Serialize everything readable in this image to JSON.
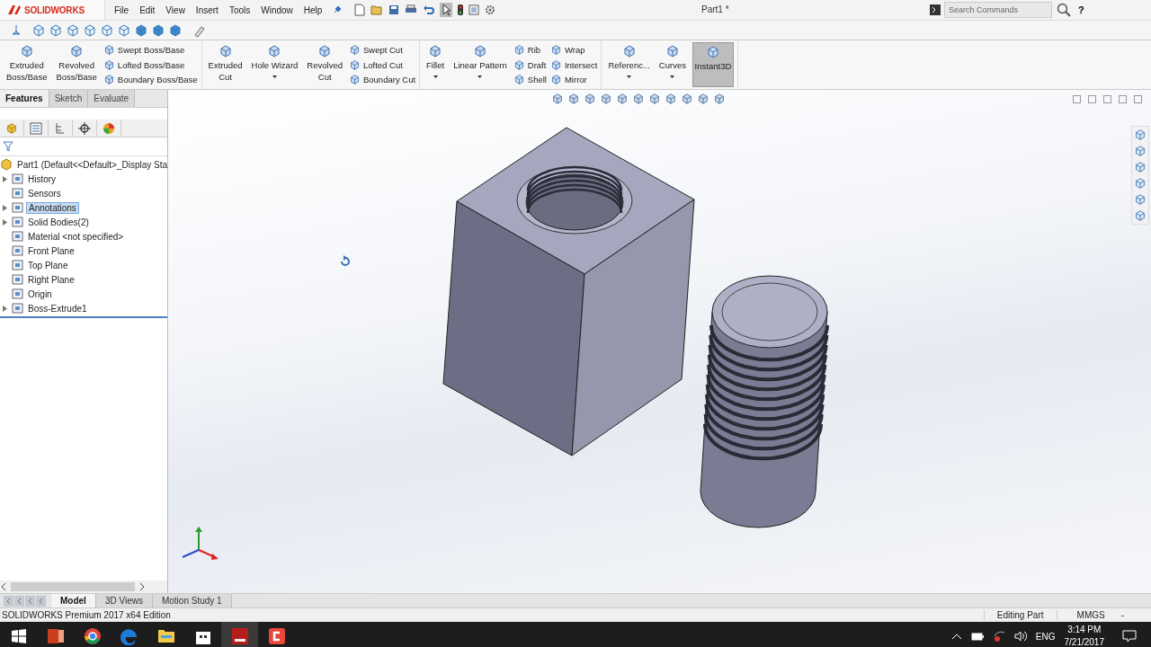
{
  "app": {
    "logo_text": "SOLIDWORKS",
    "menu": [
      "File",
      "Edit",
      "View",
      "Insert",
      "Tools",
      "Window",
      "Help"
    ],
    "document_title": "Part1 *",
    "search": {
      "placeholder": "Search Commands"
    },
    "help": "?"
  },
  "ribbon": [
    {
      "items": [
        {
          "kind": "large",
          "lines": [
            "Extruded",
            "Boss/Base"
          ]
        },
        {
          "kind": "large",
          "lines": [
            "Revolved",
            "Boss/Base"
          ]
        },
        {
          "kind": "stack",
          "labels": [
            "Swept Boss/Base",
            "Lofted Boss/Base",
            "Boundary Boss/Base"
          ]
        }
      ]
    },
    {
      "items": [
        {
          "kind": "large",
          "lines": [
            "Extruded",
            "Cut"
          ]
        },
        {
          "kind": "large",
          "lines": [
            "Hole Wizard"
          ],
          "menu": true
        },
        {
          "kind": "large",
          "lines": [
            "Revolved",
            "Cut"
          ]
        },
        {
          "kind": "stack",
          "labels": [
            "Swept Cut",
            "Lofted Cut",
            "Boundary Cut"
          ]
        }
      ]
    },
    {
      "items": [
        {
          "kind": "large",
          "lines": [
            "Fillet"
          ],
          "menu": true
        },
        {
          "kind": "large",
          "lines": [
            "Linear Pattern"
          ],
          "menu": true
        },
        {
          "kind": "stack",
          "labels": [
            "Rib",
            "Draft",
            "Shell"
          ]
        },
        {
          "kind": "stack",
          "labels": [
            "Wrap",
            "Intersect",
            "Mirror"
          ]
        }
      ]
    },
    {
      "items": [
        {
          "kind": "large",
          "lines": [
            "Referenc..."
          ],
          "menu": true
        },
        {
          "kind": "large",
          "lines": [
            "Curves"
          ],
          "menu": true
        },
        {
          "kind": "large",
          "lines": [
            "Instant3D"
          ],
          "selected": true
        }
      ]
    }
  ],
  "command_tabs": [
    {
      "label": "Features",
      "selected": true
    },
    {
      "label": "Sketch",
      "selected": false
    },
    {
      "label": "Evaluate",
      "selected": false
    }
  ],
  "tree": {
    "root": "Part1  (Default<<Default>_Display Sta",
    "items": [
      {
        "label": "History",
        "expandable": true,
        "selected": false
      },
      {
        "label": "Sensors",
        "expandable": false,
        "selected": false
      },
      {
        "label": "Annotations",
        "expandable": true,
        "selected": true
      },
      {
        "label": "Solid Bodies(2)",
        "expandable": true,
        "selected": false
      },
      {
        "label": "Material <not specified>",
        "expandable": false,
        "selected": false
      },
      {
        "label": "Front Plane",
        "expandable": false,
        "selected": false
      },
      {
        "label": "Top Plane",
        "expandable": false,
        "selected": false
      },
      {
        "label": "Right Plane",
        "expandable": false,
        "selected": false
      },
      {
        "label": "Origin",
        "expandable": false,
        "selected": false
      },
      {
        "label": "Boss-Extrude1",
        "expandable": true,
        "selected": false
      }
    ]
  },
  "model_tabs": [
    {
      "label": "Model",
      "selected": true
    },
    {
      "label": "3D Views",
      "selected": false
    },
    {
      "label": "Motion Study 1",
      "selected": false
    }
  ],
  "status_bar": {
    "edition": "SOLIDWORKS Premium 2017 x64 Edition",
    "mode": "Editing Part",
    "units": "MMGS",
    "units_menu": "-"
  },
  "taskbar": {
    "language": "ENG",
    "time": "3:14 PM",
    "date": "7/21/2017"
  }
}
